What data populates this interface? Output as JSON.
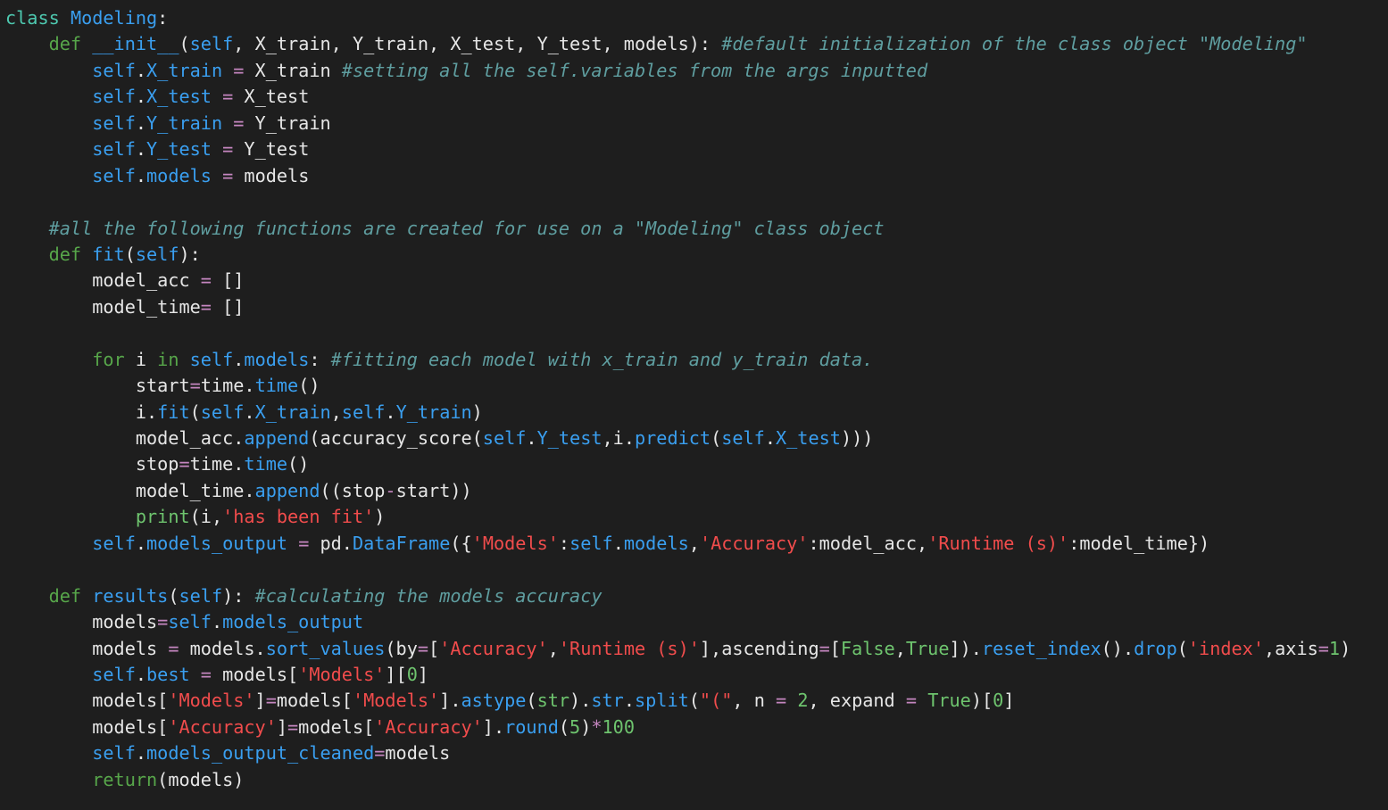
{
  "editor": {
    "language": "python",
    "theme_colors": {
      "background": "#1e1e1e",
      "plain": "#e6e6e6",
      "keyword": "#57a64a",
      "class_keyword": "#4ec9b0",
      "function_and_attr": "#3a9ff0",
      "operator": "#c586c0",
      "string": "#f14c4c",
      "number_and_constant": "#6ec46e",
      "comment": "#5f9ea0"
    },
    "lines": [
      [
        [
          "tok-kw",
          "class"
        ],
        [
          "tok-plain",
          " "
        ],
        [
          "tok-fn",
          "Modeling"
        ],
        [
          "tok-plain",
          ":"
        ]
      ],
      [
        [
          "tok-plain",
          "    "
        ],
        [
          "tok-def",
          "def"
        ],
        [
          "tok-plain",
          " "
        ],
        [
          "tok-fn",
          "__init__"
        ],
        [
          "tok-plain",
          "("
        ],
        [
          "tok-self",
          "self"
        ],
        [
          "tok-plain",
          ", X_train, Y_train, X_test, Y_test, models): "
        ],
        [
          "tok-com",
          "#default initialization of the class object \"Modeling\""
        ]
      ],
      [
        [
          "tok-plain",
          "        "
        ],
        [
          "tok-self",
          "self"
        ],
        [
          "tok-plain",
          "."
        ],
        [
          "tok-attr",
          "X_train"
        ],
        [
          "tok-plain",
          " "
        ],
        [
          "tok-op",
          "="
        ],
        [
          "tok-plain",
          " X_train "
        ],
        [
          "tok-com",
          "#setting all the self.variables from the args inputted"
        ]
      ],
      [
        [
          "tok-plain",
          "        "
        ],
        [
          "tok-self",
          "self"
        ],
        [
          "tok-plain",
          "."
        ],
        [
          "tok-attr",
          "X_test"
        ],
        [
          "tok-plain",
          " "
        ],
        [
          "tok-op",
          "="
        ],
        [
          "tok-plain",
          " X_test"
        ]
      ],
      [
        [
          "tok-plain",
          "        "
        ],
        [
          "tok-self",
          "self"
        ],
        [
          "tok-plain",
          "."
        ],
        [
          "tok-attr",
          "Y_train"
        ],
        [
          "tok-plain",
          " "
        ],
        [
          "tok-op",
          "="
        ],
        [
          "tok-plain",
          " Y_train"
        ]
      ],
      [
        [
          "tok-plain",
          "        "
        ],
        [
          "tok-self",
          "self"
        ],
        [
          "tok-plain",
          "."
        ],
        [
          "tok-attr",
          "Y_test"
        ],
        [
          "tok-plain",
          " "
        ],
        [
          "tok-op",
          "="
        ],
        [
          "tok-plain",
          " Y_test"
        ]
      ],
      [
        [
          "tok-plain",
          "        "
        ],
        [
          "tok-self",
          "self"
        ],
        [
          "tok-plain",
          "."
        ],
        [
          "tok-attr",
          "models"
        ],
        [
          "tok-plain",
          " "
        ],
        [
          "tok-op",
          "="
        ],
        [
          "tok-plain",
          " models"
        ]
      ],
      [
        [
          "tok-plain",
          ""
        ]
      ],
      [
        [
          "tok-plain",
          "    "
        ],
        [
          "tok-com",
          "#all the following functions are created for use on a \"Modeling\" class object"
        ]
      ],
      [
        [
          "tok-plain",
          "    "
        ],
        [
          "tok-def",
          "def"
        ],
        [
          "tok-plain",
          " "
        ],
        [
          "tok-fn",
          "fit"
        ],
        [
          "tok-plain",
          "("
        ],
        [
          "tok-self",
          "self"
        ],
        [
          "tok-plain",
          "):"
        ]
      ],
      [
        [
          "tok-plain",
          "        model_acc "
        ],
        [
          "tok-op",
          "="
        ],
        [
          "tok-plain",
          " []"
        ]
      ],
      [
        [
          "tok-plain",
          "        model_time"
        ],
        [
          "tok-op",
          "="
        ],
        [
          "tok-plain",
          " []"
        ]
      ],
      [
        [
          "tok-plain",
          ""
        ]
      ],
      [
        [
          "tok-plain",
          "        "
        ],
        [
          "tok-def",
          "for"
        ],
        [
          "tok-plain",
          " i "
        ],
        [
          "tok-def",
          "in"
        ],
        [
          "tok-plain",
          " "
        ],
        [
          "tok-self",
          "self"
        ],
        [
          "tok-plain",
          "."
        ],
        [
          "tok-attr",
          "models"
        ],
        [
          "tok-plain",
          ": "
        ],
        [
          "tok-com",
          "#fitting each model with x_train and y_train data."
        ]
      ],
      [
        [
          "tok-plain",
          "            start"
        ],
        [
          "tok-op",
          "="
        ],
        [
          "tok-plain",
          "time."
        ],
        [
          "tok-fn",
          "time"
        ],
        [
          "tok-plain",
          "()"
        ]
      ],
      [
        [
          "tok-plain",
          "            i."
        ],
        [
          "tok-fn",
          "fit"
        ],
        [
          "tok-plain",
          "("
        ],
        [
          "tok-self",
          "self"
        ],
        [
          "tok-plain",
          "."
        ],
        [
          "tok-attr",
          "X_train"
        ],
        [
          "tok-plain",
          ","
        ],
        [
          "tok-self",
          "self"
        ],
        [
          "tok-plain",
          "."
        ],
        [
          "tok-attr",
          "Y_train"
        ],
        [
          "tok-plain",
          ")"
        ]
      ],
      [
        [
          "tok-plain",
          "            model_acc."
        ],
        [
          "tok-fn",
          "append"
        ],
        [
          "tok-plain",
          "(accuracy_score("
        ],
        [
          "tok-self",
          "self"
        ],
        [
          "tok-plain",
          "."
        ],
        [
          "tok-attr",
          "Y_test"
        ],
        [
          "tok-plain",
          ",i."
        ],
        [
          "tok-fn",
          "predict"
        ],
        [
          "tok-plain",
          "("
        ],
        [
          "tok-self",
          "self"
        ],
        [
          "tok-plain",
          "."
        ],
        [
          "tok-attr",
          "X_test"
        ],
        [
          "tok-plain",
          ")))"
        ]
      ],
      [
        [
          "tok-plain",
          "            stop"
        ],
        [
          "tok-op",
          "="
        ],
        [
          "tok-plain",
          "time."
        ],
        [
          "tok-fn",
          "time"
        ],
        [
          "tok-plain",
          "()"
        ]
      ],
      [
        [
          "tok-plain",
          "            model_time."
        ],
        [
          "tok-fn",
          "append"
        ],
        [
          "tok-plain",
          "((stop"
        ],
        [
          "tok-op",
          "-"
        ],
        [
          "tok-plain",
          "start))"
        ]
      ],
      [
        [
          "tok-plain",
          "            "
        ],
        [
          "tok-builtin",
          "print"
        ],
        [
          "tok-plain",
          "(i,"
        ],
        [
          "tok-str",
          "'has been fit'"
        ],
        [
          "tok-plain",
          ")"
        ]
      ],
      [
        [
          "tok-plain",
          "        "
        ],
        [
          "tok-self",
          "self"
        ],
        [
          "tok-plain",
          "."
        ],
        [
          "tok-attr",
          "models_output"
        ],
        [
          "tok-plain",
          " "
        ],
        [
          "tok-op",
          "="
        ],
        [
          "tok-plain",
          " pd."
        ],
        [
          "tok-fn",
          "DataFrame"
        ],
        [
          "tok-plain",
          "({"
        ],
        [
          "tok-str",
          "'Models'"
        ],
        [
          "tok-plain",
          ":"
        ],
        [
          "tok-self",
          "self"
        ],
        [
          "tok-plain",
          "."
        ],
        [
          "tok-attr",
          "models"
        ],
        [
          "tok-plain",
          ","
        ],
        [
          "tok-str",
          "'Accuracy'"
        ],
        [
          "tok-plain",
          ":model_acc,"
        ],
        [
          "tok-str",
          "'Runtime (s)'"
        ],
        [
          "tok-plain",
          ":model_time})"
        ]
      ],
      [
        [
          "tok-plain",
          ""
        ]
      ],
      [
        [
          "tok-plain",
          "    "
        ],
        [
          "tok-def",
          "def"
        ],
        [
          "tok-plain",
          " "
        ],
        [
          "tok-fn",
          "results"
        ],
        [
          "tok-plain",
          "("
        ],
        [
          "tok-self",
          "self"
        ],
        [
          "tok-plain",
          "): "
        ],
        [
          "tok-com",
          "#calculating the models accuracy"
        ]
      ],
      [
        [
          "tok-plain",
          "        models"
        ],
        [
          "tok-op",
          "="
        ],
        [
          "tok-self",
          "self"
        ],
        [
          "tok-plain",
          "."
        ],
        [
          "tok-attr",
          "models_output"
        ]
      ],
      [
        [
          "tok-plain",
          "        models "
        ],
        [
          "tok-op",
          "="
        ],
        [
          "tok-plain",
          " models."
        ],
        [
          "tok-fn",
          "sort_values"
        ],
        [
          "tok-plain",
          "(by"
        ],
        [
          "tok-op",
          "="
        ],
        [
          "tok-plain",
          "["
        ],
        [
          "tok-str",
          "'Accuracy'"
        ],
        [
          "tok-plain",
          ","
        ],
        [
          "tok-str",
          "'Runtime (s)'"
        ],
        [
          "tok-plain",
          "],ascending"
        ],
        [
          "tok-op",
          "="
        ],
        [
          "tok-plain",
          "["
        ],
        [
          "tok-const",
          "False"
        ],
        [
          "tok-plain",
          ","
        ],
        [
          "tok-const",
          "True"
        ],
        [
          "tok-plain",
          "])."
        ],
        [
          "tok-fn",
          "reset_index"
        ],
        [
          "tok-plain",
          "()."
        ],
        [
          "tok-fn",
          "drop"
        ],
        [
          "tok-plain",
          "("
        ],
        [
          "tok-str",
          "'index'"
        ],
        [
          "tok-plain",
          ",axis"
        ],
        [
          "tok-op",
          "="
        ],
        [
          "tok-num",
          "1"
        ],
        [
          "tok-plain",
          ")"
        ]
      ],
      [
        [
          "tok-plain",
          "        "
        ],
        [
          "tok-self",
          "self"
        ],
        [
          "tok-plain",
          "."
        ],
        [
          "tok-attr",
          "best"
        ],
        [
          "tok-plain",
          " "
        ],
        [
          "tok-op",
          "="
        ],
        [
          "tok-plain",
          " models["
        ],
        [
          "tok-str",
          "'Models'"
        ],
        [
          "tok-plain",
          "]["
        ],
        [
          "tok-num",
          "0"
        ],
        [
          "tok-plain",
          "]"
        ]
      ],
      [
        [
          "tok-plain",
          "        models["
        ],
        [
          "tok-str",
          "'Models'"
        ],
        [
          "tok-plain",
          "]"
        ],
        [
          "tok-op",
          "="
        ],
        [
          "tok-plain",
          "models["
        ],
        [
          "tok-str",
          "'Models'"
        ],
        [
          "tok-plain",
          "]."
        ],
        [
          "tok-fn",
          "astype"
        ],
        [
          "tok-plain",
          "("
        ],
        [
          "tok-builtin",
          "str"
        ],
        [
          "tok-plain",
          ")."
        ],
        [
          "tok-fn",
          "str"
        ],
        [
          "tok-plain",
          "."
        ],
        [
          "tok-fn",
          "split"
        ],
        [
          "tok-plain",
          "("
        ],
        [
          "tok-str",
          "\"(\""
        ],
        [
          "tok-plain",
          ", n "
        ],
        [
          "tok-op",
          "="
        ],
        [
          "tok-plain",
          " "
        ],
        [
          "tok-num",
          "2"
        ],
        [
          "tok-plain",
          ", expand "
        ],
        [
          "tok-op",
          "="
        ],
        [
          "tok-plain",
          " "
        ],
        [
          "tok-const",
          "True"
        ],
        [
          "tok-plain",
          ")["
        ],
        [
          "tok-num",
          "0"
        ],
        [
          "tok-plain",
          "]"
        ]
      ],
      [
        [
          "tok-plain",
          "        models["
        ],
        [
          "tok-str",
          "'Accuracy'"
        ],
        [
          "tok-plain",
          "]"
        ],
        [
          "tok-op",
          "="
        ],
        [
          "tok-plain",
          "models["
        ],
        [
          "tok-str",
          "'Accuracy'"
        ],
        [
          "tok-plain",
          "]."
        ],
        [
          "tok-fn",
          "round"
        ],
        [
          "tok-plain",
          "("
        ],
        [
          "tok-num",
          "5"
        ],
        [
          "tok-plain",
          ")"
        ],
        [
          "tok-op",
          "*"
        ],
        [
          "tok-num",
          "100"
        ]
      ],
      [
        [
          "tok-plain",
          "        "
        ],
        [
          "tok-self",
          "self"
        ],
        [
          "tok-plain",
          "."
        ],
        [
          "tok-attr",
          "models_output_cleaned"
        ],
        [
          "tok-op",
          "="
        ],
        [
          "tok-plain",
          "models"
        ]
      ],
      [
        [
          "tok-plain",
          "        "
        ],
        [
          "tok-def",
          "return"
        ],
        [
          "tok-plain",
          "(models)"
        ]
      ]
    ]
  }
}
